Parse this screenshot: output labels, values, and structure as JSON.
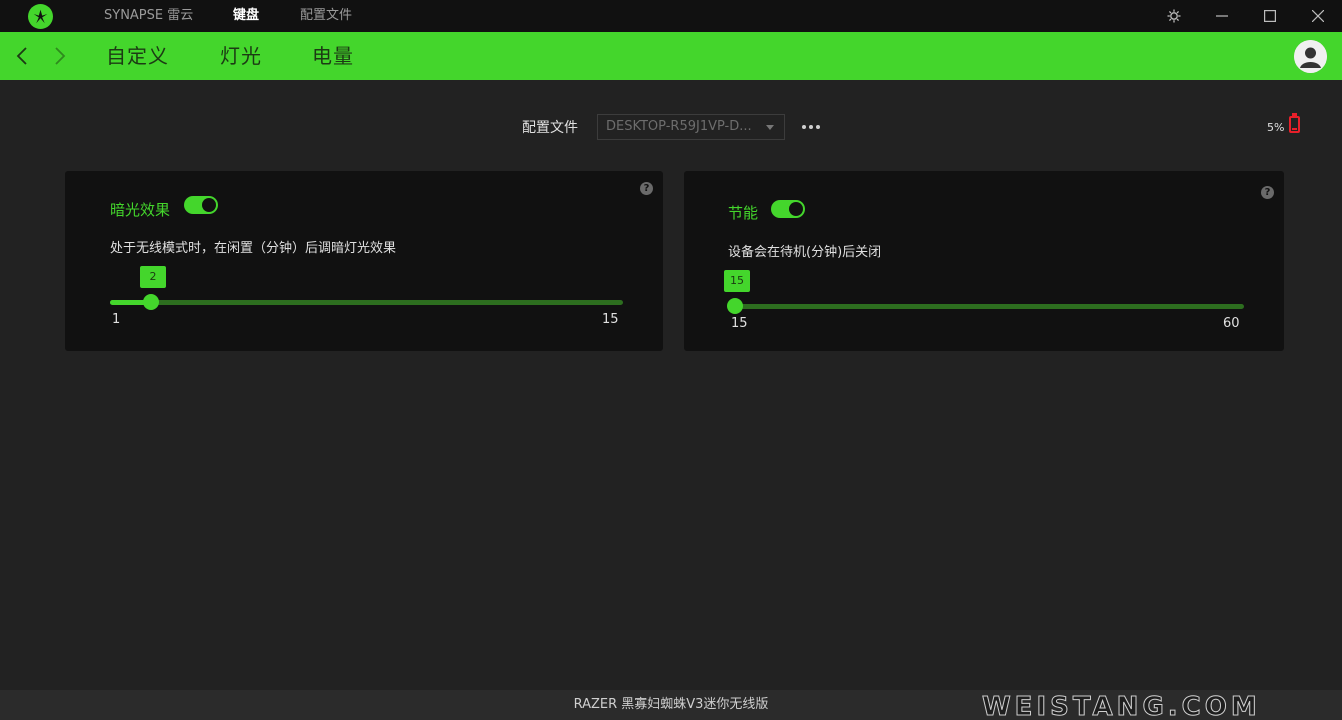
{
  "titlebar": {
    "tabs": [
      {
        "label": "SYNAPSE 雷云",
        "active": false
      },
      {
        "label": "键盘",
        "active": true
      },
      {
        "label": "配置文件",
        "active": false
      }
    ],
    "icons": [
      "settings-icon",
      "minimize-icon",
      "maximize-icon",
      "close-icon"
    ]
  },
  "nav": {
    "tabs": [
      {
        "label": "自定义"
      },
      {
        "label": "灯光"
      },
      {
        "label": "电量"
      }
    ]
  },
  "profile": {
    "label": "配置文件",
    "selected": "DESKTOP-R59J1VP-D..."
  },
  "battery": {
    "percent": "5%",
    "level": 0.05,
    "color": "#e8202a"
  },
  "cards": [
    {
      "title": "暗光效果",
      "enabled": true,
      "description": "处于无线模式时，在闲置（分钟）后调暗灯光效果",
      "slider": {
        "value": "2",
        "min": "1",
        "max": "15"
      }
    },
    {
      "title": "节能",
      "enabled": true,
      "description": "设备会在待机(分钟)后关闭",
      "slider": {
        "value": "15",
        "min": "15",
        "max": "60"
      }
    }
  ],
  "footer": {
    "device": "RAZER 黑寡妇蜘蛛V3迷你无线版",
    "watermark": "WEISTANG.COM"
  },
  "colors": {
    "accent": "#44d62c",
    "background": "#222222",
    "card": "#111111"
  }
}
